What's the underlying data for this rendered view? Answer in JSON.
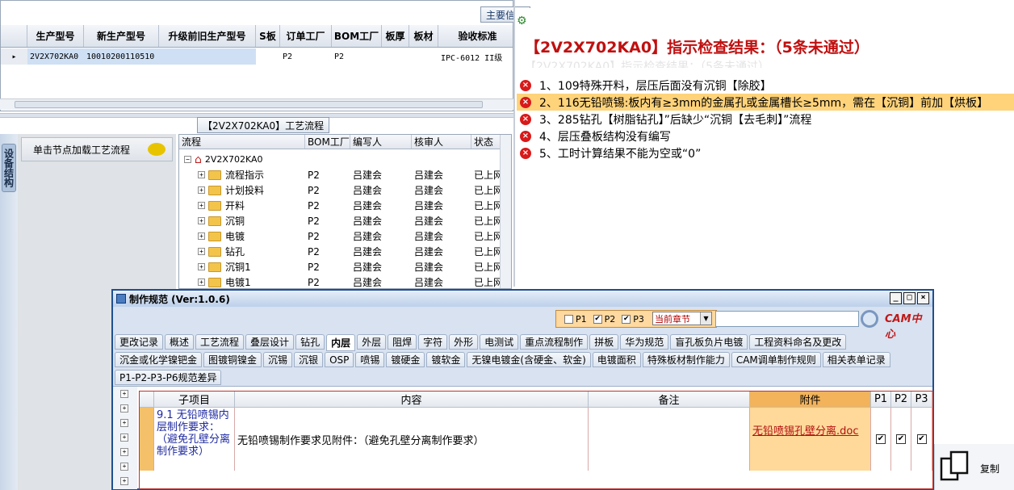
{
  "grid": {
    "main_tab": "主要信息",
    "columns": [
      "生产型号",
      "新生产型号",
      "升级前旧生产型号",
      "S板",
      "订单工厂",
      "BOM工厂",
      "板厚",
      "板材",
      "验收标准"
    ],
    "row": [
      "2V2X702KA0",
      "10010200110510",
      "",
      "",
      "P2",
      "P2",
      "",
      "",
      "IPC-6012 II级"
    ],
    "row_marker": "▸"
  },
  "process": {
    "title": "【2V2X702KA0】工艺流程",
    "side_tab": "设备结构",
    "load_hint": "单击节点加载工艺流程",
    "columns": [
      "流程",
      "BOM工厂",
      "编写人",
      "核审人",
      "状态"
    ],
    "root": "2V2X702KA0",
    "rows": [
      {
        "name": "流程指示",
        "bom": "P2",
        "writer": "吕建会",
        "reviewer": "吕建会",
        "status": "已上网"
      },
      {
        "name": "计划投料",
        "bom": "P2",
        "writer": "吕建会",
        "reviewer": "吕建会",
        "status": "已上网"
      },
      {
        "name": "开料",
        "bom": "P2",
        "writer": "吕建会",
        "reviewer": "吕建会",
        "status": "已上网"
      },
      {
        "name": "沉铜",
        "bom": "P2",
        "writer": "吕建会",
        "reviewer": "吕建会",
        "status": "已上网"
      },
      {
        "name": "电镀",
        "bom": "P2",
        "writer": "吕建会",
        "reviewer": "吕建会",
        "status": "已上网"
      },
      {
        "name": "钻孔",
        "bom": "P2",
        "writer": "吕建会",
        "reviewer": "吕建会",
        "status": "已上网"
      },
      {
        "name": "沉铜1",
        "bom": "P2",
        "writer": "吕建会",
        "reviewer": "吕建会",
        "status": "已上网"
      },
      {
        "name": "电镀1",
        "bom": "P2",
        "writer": "吕建会",
        "reviewer": "吕建会",
        "status": "已上网"
      }
    ]
  },
  "check": {
    "title": "【2V2X702KA0】指示检查结果：（5条未通过）",
    "items": [
      "1、109特殊开料，层压后面没有沉铜【除胶】",
      "2、116无铅喷锡:板内有≥3mm的金属孔或金属槽长≥5mm，需在【沉铜】前加【烘板】",
      "3、285钻孔【树脂钻孔】”后缺少“沉铜【去毛刺】”流程",
      "4、层压叠板结构没有编写",
      "5、工时计算结果不能为空或“0”"
    ],
    "highlight_index": 1
  },
  "dialog": {
    "title": "制作规范 (Ver:1.0.6)",
    "filter": {
      "p1": "P1",
      "p2": "P2",
      "p3": "P3",
      "chapter": "当前章节"
    },
    "logo": "CAM中心",
    "tabs_row1": [
      "更改记录",
      "概述",
      "工艺流程",
      "叠层设计",
      "钻孔",
      "内层",
      "外层",
      "阻焊",
      "字符",
      "外形",
      "电测试",
      "重点流程制作",
      "拼板",
      "华为规范",
      "盲孔板负片电镀",
      "工程资料命名及更改"
    ],
    "tabs_row2": [
      "沉金或化学镍钯金",
      "图镀铜镍金",
      "沉锡",
      "沉银",
      "OSP",
      "喷锡",
      "镀硬金",
      "镀软金",
      "无镍电镀金(含硬金、软金)",
      "电镀面积",
      "特殊板材制作能力",
      "CAM调单制作规则",
      "相关表单记录"
    ],
    "tabs_row3": [
      "P1-P2-P3-P6规范差异"
    ],
    "active_tab": "内层",
    "table_headers": [
      "子项目",
      "内容",
      "备注",
      "附件",
      "P1",
      "P2",
      "P3"
    ],
    "row": {
      "sub": "9.1 无铅喷锡内层制作要求：（避免孔壁分离制作要求）",
      "content": "无铅喷锡制作要求见附件：（避免孔壁分离制作要求）",
      "note": "",
      "attachment": "无铅喷锡孔壁分离.doc",
      "p1": "✔",
      "p2": "✔",
      "p3": "✔"
    }
  },
  "copy_label": "复制"
}
